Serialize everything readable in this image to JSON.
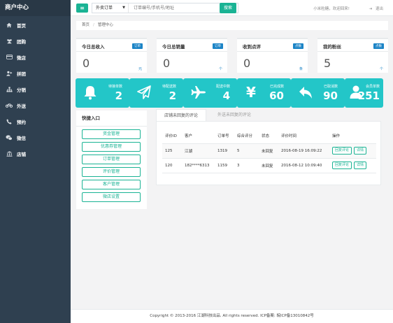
{
  "sidebar": {
    "brand": "商户中心",
    "items": [
      {
        "label": "首页",
        "icon": "home-icon"
      },
      {
        "label": "团购",
        "icon": "group-buy-icon"
      },
      {
        "label": "微店",
        "icon": "card-icon"
      },
      {
        "label": "拼团",
        "icon": "team-icon"
      },
      {
        "label": "分销",
        "icon": "sitemap-icon"
      },
      {
        "label": "外送",
        "icon": "motorcycle-icon"
      },
      {
        "label": "预约",
        "icon": "phone-icon"
      },
      {
        "label": "微信",
        "icon": "wechat-icon"
      },
      {
        "label": "店铺",
        "icon": "bank-icon"
      }
    ]
  },
  "topbar": {
    "menu_button": "≡",
    "search_type": "外卖订单",
    "search_placeholder": "订单编号/手机号/地址",
    "search_button": "搜索",
    "welcome": "小米粒糖，欢迎回来!",
    "logout": "退出"
  },
  "breadcrumb": {
    "home": "首页",
    "current": "管理中心"
  },
  "stats": [
    {
      "title": "今日总收入",
      "badge": "订单",
      "value": "0",
      "unit": "元"
    },
    {
      "title": "今日总销量",
      "badge": "订单",
      "value": "0",
      "unit": "个"
    },
    {
      "title": "收到点评",
      "badge": "点数",
      "value": "0",
      "unit": "条"
    },
    {
      "title": "我的粉丝",
      "badge": "点数",
      "value": "5",
      "unit": "个"
    }
  ],
  "tiles": [
    {
      "label": "待接单数",
      "value": "2",
      "icon": "bell-icon"
    },
    {
      "label": "待配送数",
      "value": "2",
      "icon": "paper-plane-icon"
    },
    {
      "label": "配送中数",
      "value": "4",
      "icon": "plane-icon"
    },
    {
      "label": "已完成数",
      "value": "60",
      "icon": "yen-icon"
    },
    {
      "label": "已取消数",
      "value": "90",
      "icon": "reply-icon"
    },
    {
      "label": "会员单数",
      "value": "251",
      "icon": "user-icon"
    }
  ],
  "quick_entry": {
    "title": "快捷入口",
    "buttons": [
      "资金管理",
      "优惠券管理",
      "订单管理",
      "评价管理",
      "客户管理",
      "微店设置"
    ]
  },
  "reviews": {
    "tabs": [
      "店铺未回复的评论",
      "外送未回复的评论"
    ],
    "columns": [
      "评价ID",
      "客户",
      "订单号",
      "综合评分",
      "状态",
      "评价时间",
      "操作"
    ],
    "rows": [
      {
        "id": "125",
        "customer": "江湖",
        "order": "1319",
        "score": "5",
        "status": "未回复",
        "time": "2016-08-19 16:09:22"
      },
      {
        "id": "120",
        "customer": "182****6313",
        "order": "1159",
        "score": "3",
        "status": "未回复",
        "time": "2016-08-12 10:09:40"
      }
    ],
    "reply_button": "回复评论",
    "detail_button": "详情"
  },
  "footer": "Copyright © 2013-2016 江湖科技出品. All rights reserved. ICP备案: 皖ICP备13010842号",
  "colors": {
    "sidebar": "#2f4050",
    "accent": "#1ab394",
    "tile": "#23c6c8",
    "badge": "#1c84c6"
  }
}
